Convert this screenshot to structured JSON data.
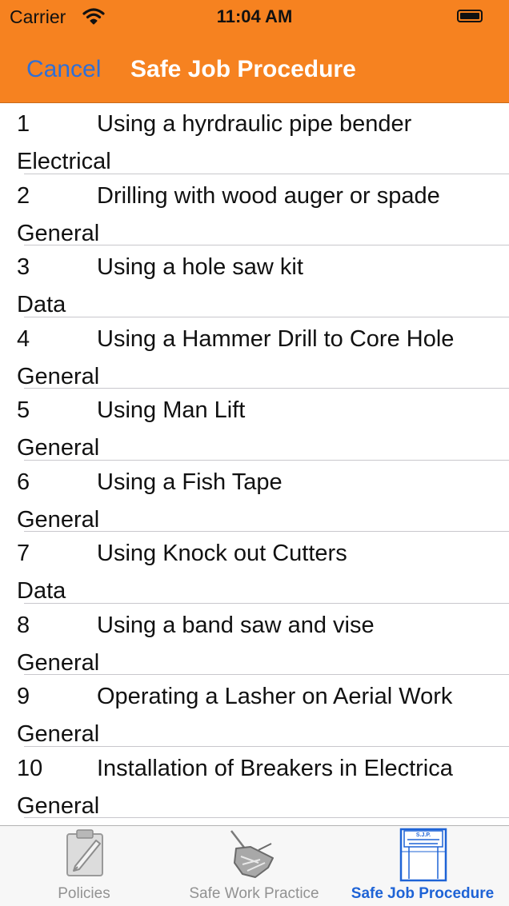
{
  "status_bar": {
    "carrier": "Carrier",
    "time": "11:04 AM"
  },
  "nav": {
    "cancel_label": "Cancel",
    "title": "Safe Job Procedure"
  },
  "colors": {
    "nav_background": "#f68220",
    "accent": "#2f6fd6",
    "tab_active": "#1e63d6"
  },
  "list": {
    "items": [
      {
        "number": "1",
        "name": "Using a hyrdraulic pipe bender",
        "category": "Electrical"
      },
      {
        "number": "2",
        "name": "Drilling with wood auger or spade",
        "category": "General"
      },
      {
        "number": "3",
        "name": "Using a hole saw kit",
        "category": "Data"
      },
      {
        "number": "4",
        "name": "Using a Hammer Drill to Core Hole",
        "category": "General"
      },
      {
        "number": "5",
        "name": "Using Man Lift",
        "category": "General"
      },
      {
        "number": "6",
        "name": "Using a Fish Tape",
        "category": "General"
      },
      {
        "number": "7",
        "name": "Using Knock out Cutters",
        "category": "Data"
      },
      {
        "number": "8",
        "name": "Using a band saw and vise",
        "category": "General"
      },
      {
        "number": "9",
        "name": "Operating a Lasher on Aerial Work",
        "category": "General"
      },
      {
        "number": "10",
        "name": "Installation of Breakers in Electrica",
        "category": "General"
      }
    ]
  },
  "tabbar": {
    "tabs": [
      {
        "label": "Policies",
        "icon": "clipboard-pencil-icon",
        "active": false
      },
      {
        "label": "Safe Work Practice",
        "icon": "hand-tool-icon",
        "active": false
      },
      {
        "label": "Safe Job Procedure",
        "icon": "document-form-icon",
        "active": true
      }
    ],
    "sjp_icon_text": "S.J.P."
  }
}
